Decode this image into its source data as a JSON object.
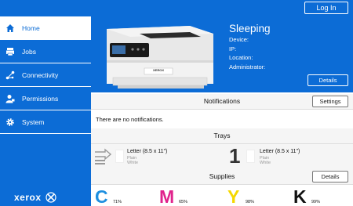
{
  "topbar": {
    "login_label": "Log In"
  },
  "sidebar": {
    "items": [
      {
        "label": "Home",
        "icon": "home-icon"
      },
      {
        "label": "Jobs",
        "icon": "jobs-icon"
      },
      {
        "label": "Connectivity",
        "icon": "connectivity-icon"
      },
      {
        "label": "Permissions",
        "icon": "permissions-icon"
      },
      {
        "label": "System",
        "icon": "gear-icon"
      }
    ],
    "brand": "xerox"
  },
  "device": {
    "status": "Sleeping",
    "fields": [
      "Device:",
      "IP:",
      "Location:",
      "Administrator:"
    ],
    "details_label": "Details",
    "printer_badge": "XEROX"
  },
  "notifications": {
    "title": "Notifications",
    "settings_label": "Settings",
    "message": "There are no notifications."
  },
  "trays": {
    "title": "Trays",
    "items": [
      {
        "label": "Letter (8.5 x 11\")",
        "type": "Plain",
        "color": "White"
      },
      {
        "number": "1",
        "label": "Letter (8.5 x 11\")",
        "type": "Plain",
        "color": "White"
      }
    ]
  },
  "supplies": {
    "title": "Supplies",
    "details_label": "Details",
    "items": [
      {
        "letter": "C",
        "percent": "71%",
        "color": "#1e8fe0"
      },
      {
        "letter": "M",
        "percent": "65%",
        "color": "#e0238c"
      },
      {
        "letter": "Y",
        "percent": "98%",
        "color": "#f5d800"
      },
      {
        "letter": "K",
        "percent": "99%",
        "color": "#111111"
      }
    ]
  },
  "colors": {
    "brand_blue": "#0c6cd6"
  }
}
